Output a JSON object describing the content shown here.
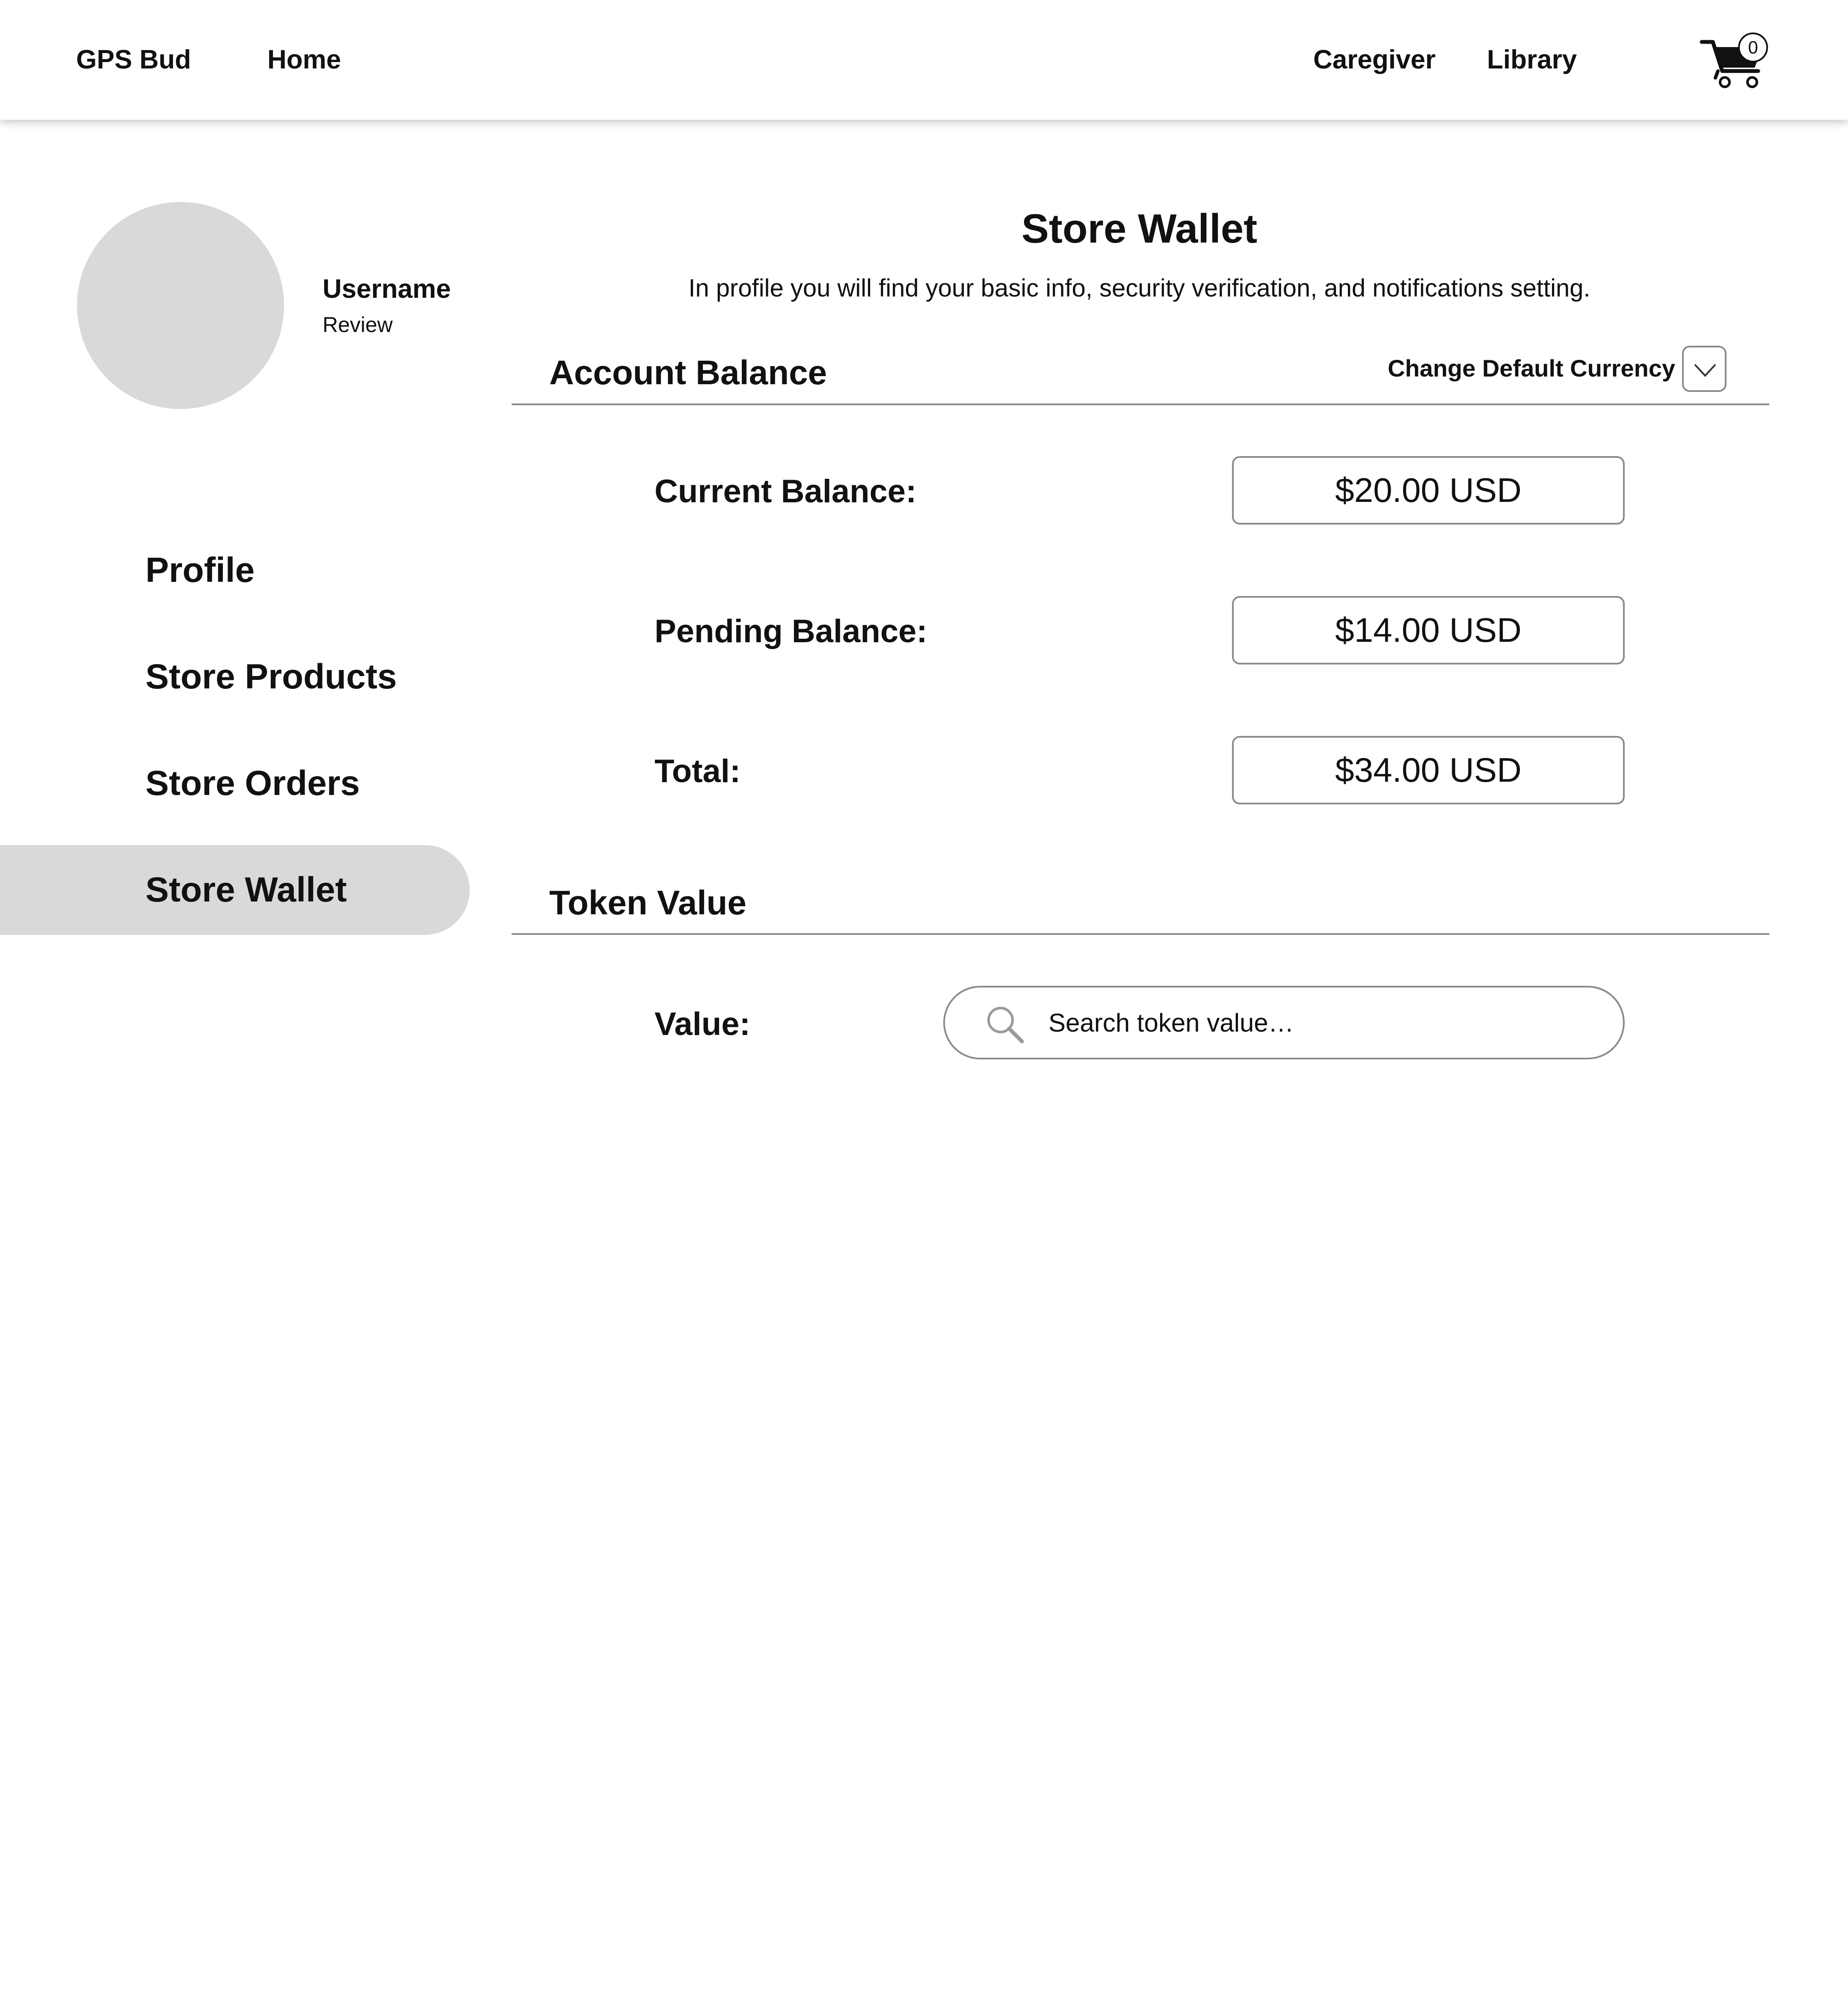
{
  "nav": {
    "brand": "GPS Bud",
    "home": "Home",
    "caregiver": "Caregiver",
    "library": "Library",
    "cart_count": "0"
  },
  "user": {
    "username": "Username",
    "subtitle": "Review"
  },
  "sidebar": {
    "items": [
      {
        "label": "Profile",
        "active": false
      },
      {
        "label": "Store Products",
        "active": false
      },
      {
        "label": "Store Orders",
        "active": false
      },
      {
        "label": "Store Wallet",
        "active": true
      }
    ]
  },
  "main": {
    "title": "Store Wallet",
    "subtitle": "In profile you will find your basic info, security verification, and notifications setting.",
    "account_balance": {
      "heading": "Account Balance",
      "currency_label": "Change Default Currency",
      "rows": [
        {
          "label": "Current Balance:",
          "value": "$20.00 USD"
        },
        {
          "label": "Pending Balance:",
          "value": "$14.00 USD"
        },
        {
          "label": "Total:",
          "value": "$34.00 USD"
        }
      ]
    },
    "token_value": {
      "heading": "Token Value",
      "label": "Value:",
      "search_placeholder": "Search token value…"
    }
  },
  "icons": {
    "cart": "shopping-cart-icon",
    "dropdown": "chevron-down-icon",
    "search": "search-icon"
  },
  "colors": {
    "active_nav_bg": "#d9d9d9",
    "avatar_bg": "#d9d9d9",
    "border": "#8a8a8a"
  }
}
